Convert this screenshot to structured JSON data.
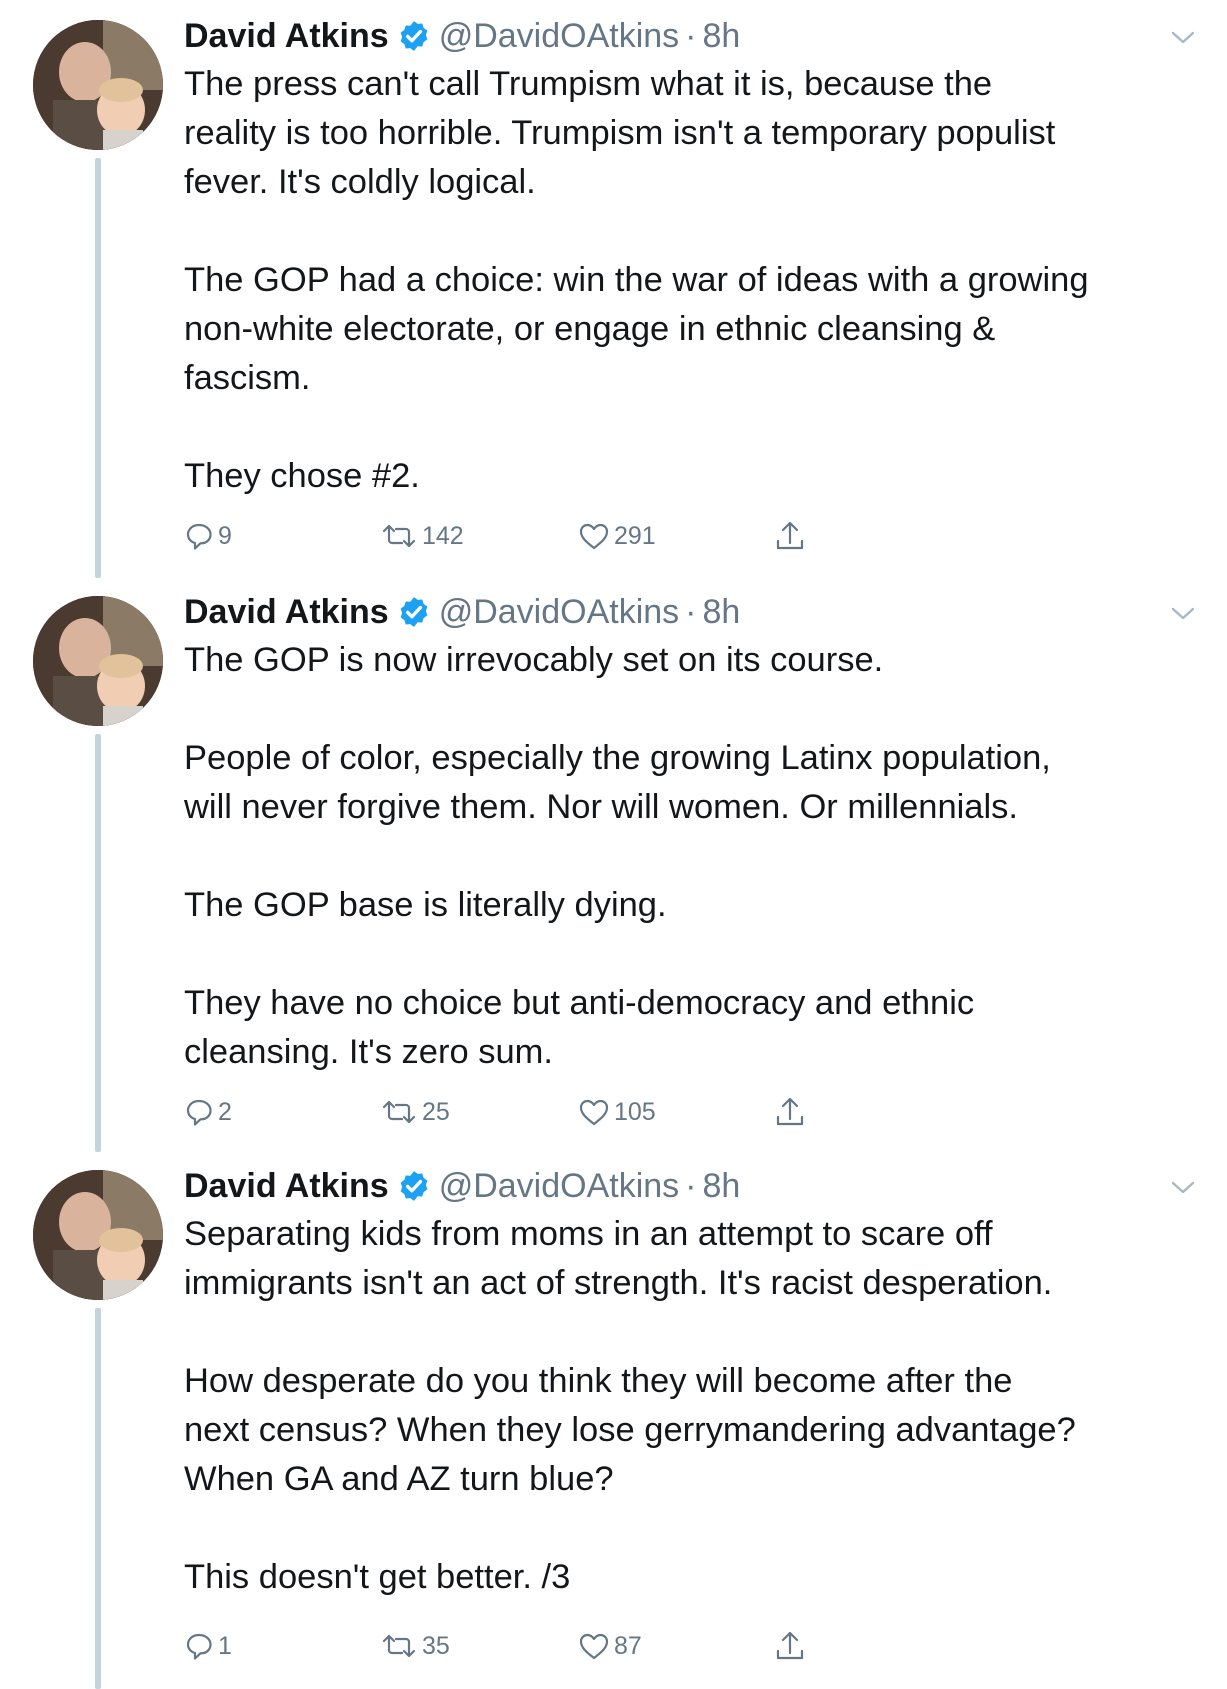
{
  "tweets": [
    {
      "name": "David Atkins",
      "handle": "@DavidOAtkins",
      "separator": "·",
      "time": "8h",
      "paragraphs": [
        "The press can't call Trumpism what it is, because the\nreality is too horrible. Trumpism isn't a temporary populist\nfever. It's coldly logical.",
        "The GOP had a choice: win the war of ideas with a growing\nnon-white electorate, or engage in ethnic cleansing &\nfascism.",
        "They chose #2."
      ],
      "replies": "9",
      "retweets": "142",
      "likes": "291"
    },
    {
      "name": "David Atkins",
      "handle": "@DavidOAtkins",
      "separator": "·",
      "time": "8h",
      "paragraphs": [
        "The GOP is now irrevocably set on its course.",
        "People of color, especially the growing Latinx population,\nwill never forgive them. Nor will women. Or millennials.",
        "The GOP base is literally dying.",
        "They have no choice but anti-democracy and ethnic\ncleansing. It's zero sum."
      ],
      "replies": "2",
      "retweets": "25",
      "likes": "105"
    },
    {
      "name": "David Atkins",
      "handle": "@DavidOAtkins",
      "separator": "·",
      "time": "8h",
      "paragraphs": [
        "Separating kids from moms in an attempt to scare off\nimmigrants isn't an act of strength. It's racist desperation.",
        "How desperate do you think they will become after the\nnext census? When they lose gerrymandering advantage?\nWhen GA and AZ turn blue?",
        "This doesn't get better. /3"
      ],
      "replies": "1",
      "retweets": "35",
      "likes": "87"
    }
  ],
  "icons": {
    "verified": "verified-badge-icon",
    "caret": "chevron-down-icon",
    "reply": "reply-icon",
    "retweet": "retweet-icon",
    "like": "heart-icon",
    "share": "share-icon"
  },
  "colors": {
    "text": "#14171a",
    "secondary": "#657786",
    "verified": "#1da1f2",
    "thread_line": "#c4d4dc"
  }
}
